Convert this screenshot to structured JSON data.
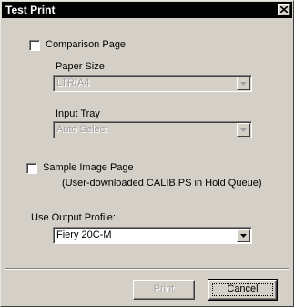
{
  "window": {
    "title": "Test Print"
  },
  "comparison_page": {
    "label": "Comparison Page",
    "checked": false
  },
  "paper_size": {
    "label": "Paper Size",
    "value": "LTR/A4"
  },
  "input_tray": {
    "label": "Input Tray",
    "value": "Auto Select"
  },
  "sample_image_page": {
    "label": "Sample Image Page",
    "checked": false,
    "note": "(User-downloaded CALIB.PS in Hold Queue)"
  },
  "output_profile": {
    "label": "Use Output Profile:",
    "value": "Fiery 20C-M"
  },
  "buttons": {
    "print": "Print",
    "cancel": "Cancel"
  },
  "icons": {
    "close": "close-icon",
    "dropdown": "chevron-down-icon"
  }
}
